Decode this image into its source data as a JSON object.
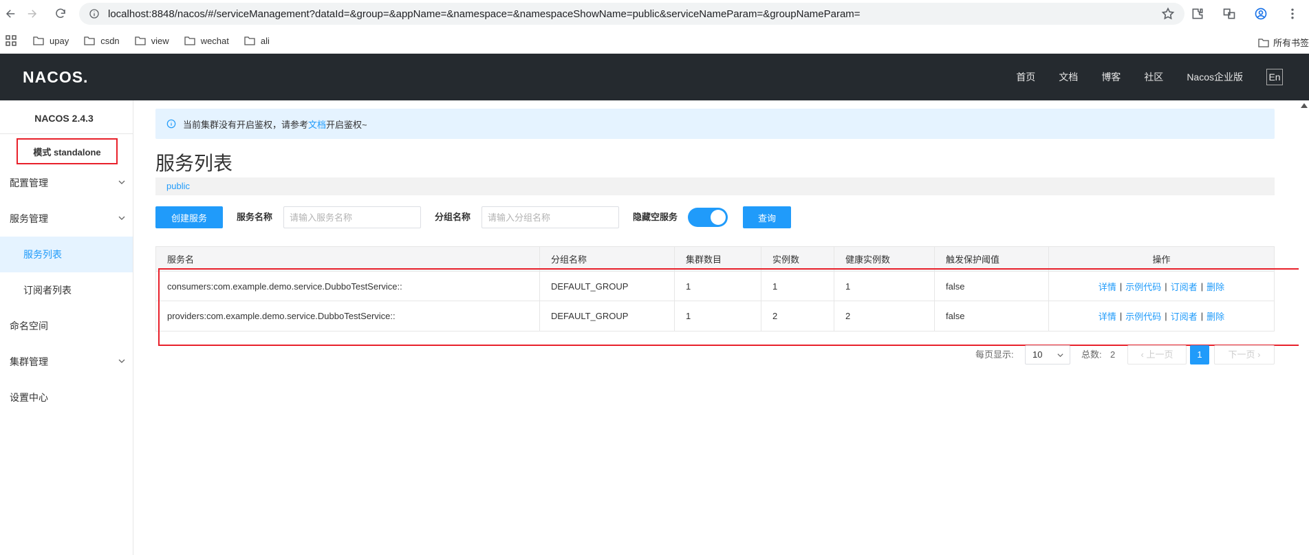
{
  "browser": {
    "url": "localhost:8848/nacos/#/serviceManagement?dataId=&group=&appName=&namespace=&namespaceShowName=public&serviceNameParam=&groupNameParam=",
    "bookmarks": [
      "upay",
      "csdn",
      "view",
      "wechat",
      "ali"
    ],
    "all_bookmarks": "所有书签"
  },
  "header": {
    "logo": "NACOS.",
    "nav": [
      "首页",
      "文档",
      "博客",
      "社区",
      "Nacos企业版"
    ],
    "lang": "En"
  },
  "sidebar": {
    "version": "NACOS 2.4.3",
    "mode": "模式 standalone",
    "items": [
      {
        "label": "配置管理"
      },
      {
        "label": "服务管理"
      },
      {
        "label": "服务列表"
      },
      {
        "label": "订阅者列表"
      },
      {
        "label": "命名空间"
      },
      {
        "label": "集群管理"
      },
      {
        "label": "设置中心"
      }
    ]
  },
  "notice": {
    "prefix": "当前集群没有开启鉴权，请参考",
    "link": "文档",
    "suffix": "开启鉴权~"
  },
  "page": {
    "title": "服务列表",
    "namespace": "public"
  },
  "toolbar": {
    "create_label": "创建服务",
    "service_name_label": "服务名称",
    "service_name_placeholder": "请输入服务名称",
    "group_name_label": "分组名称",
    "group_name_placeholder": "请输入分组名称",
    "hide_empty_label": "隐藏空服务",
    "hide_empty_on": true,
    "query_label": "查询"
  },
  "table": {
    "columns": [
      "服务名",
      "分组名称",
      "集群数目",
      "实例数",
      "健康实例数",
      "触发保护阈值",
      "操作"
    ],
    "rows": [
      {
        "name": "consumers:com.example.demo.service.DubboTestService::",
        "group": "DEFAULT_GROUP",
        "clusters": "1",
        "instances": "1",
        "healthy": "1",
        "threshold": "false"
      },
      {
        "name": "providers:com.example.demo.service.DubboTestService::",
        "group": "DEFAULT_GROUP",
        "clusters": "1",
        "instances": "2",
        "healthy": "2",
        "threshold": "false"
      }
    ],
    "ops": [
      "详情",
      "示例代码",
      "订阅者",
      "删除"
    ]
  },
  "pagination": {
    "per_page_label": "每页显示:",
    "per_page": "10",
    "total_label": "总数:",
    "total": "2",
    "prev": "上一页",
    "next": "下一页",
    "current": "1"
  },
  "colors": {
    "accent": "#209bfa",
    "header_bg": "#252a2f",
    "highlight": "#e8202a"
  }
}
